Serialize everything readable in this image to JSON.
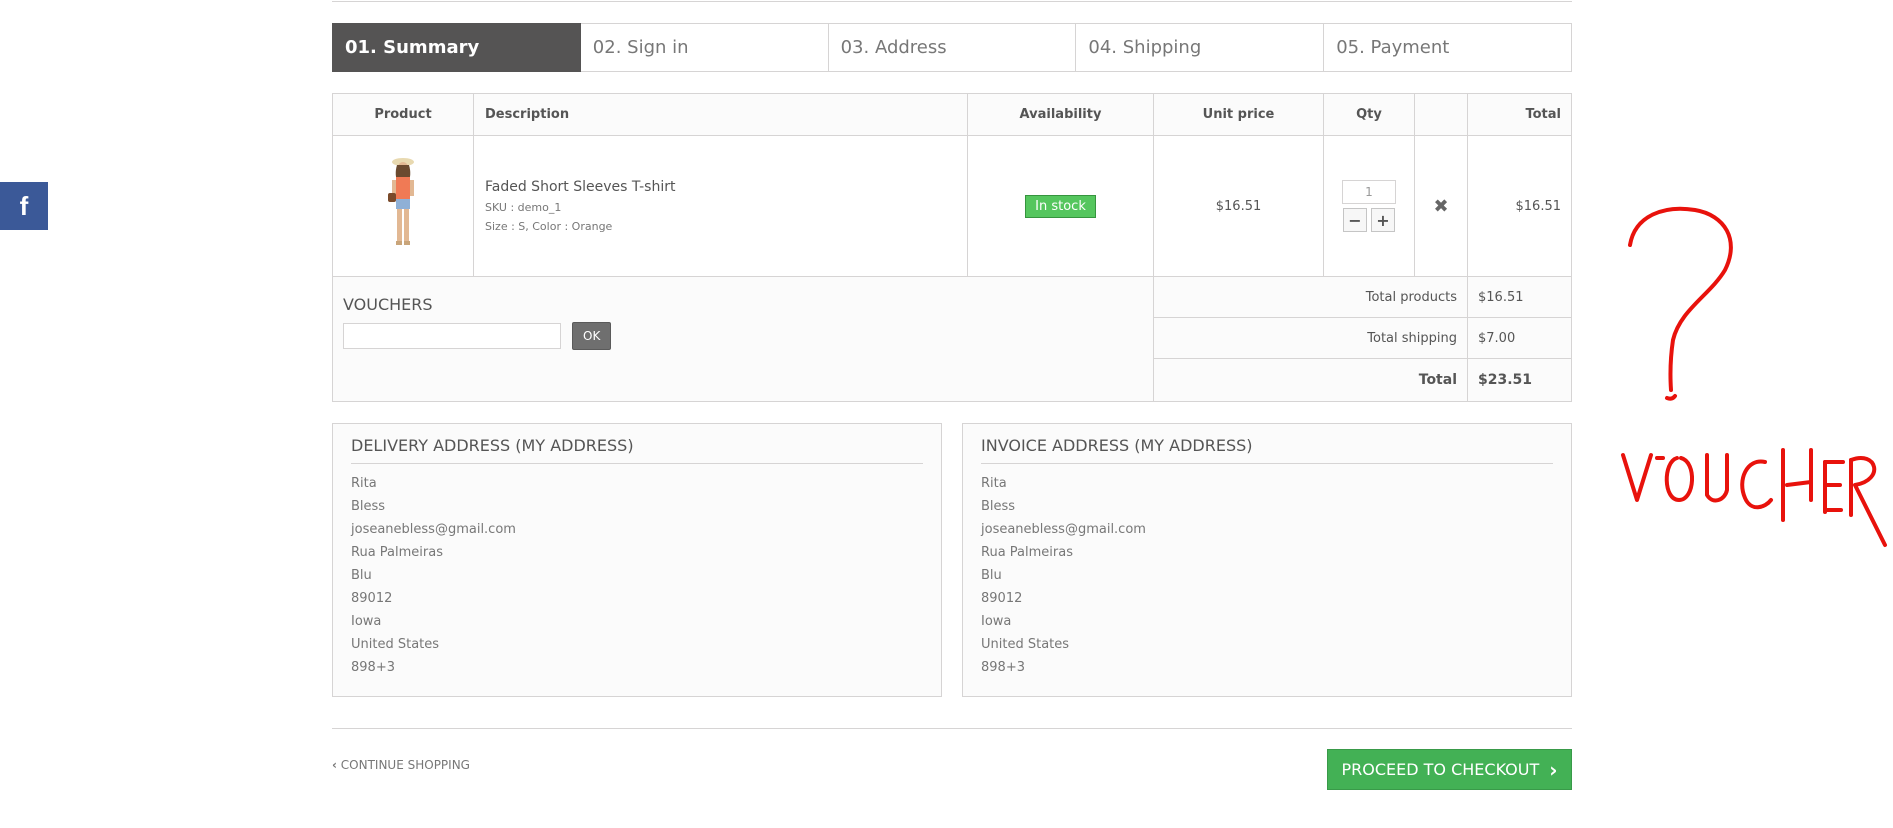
{
  "social": {
    "facebook_label": "f"
  },
  "steps": [
    {
      "label": "01. Summary",
      "active": true
    },
    {
      "label": "02. Sign in"
    },
    {
      "label": "03. Address"
    },
    {
      "label": "04. Shipping"
    },
    {
      "label": "05. Payment"
    }
  ],
  "cart": {
    "headers": {
      "product": "Product",
      "description": "Description",
      "availability": "Availability",
      "unit_price": "Unit price",
      "qty": "Qty",
      "total": "Total"
    },
    "item": {
      "name": "Faded Short Sleeves T-shirt",
      "sku": "SKU : demo_1",
      "attributes": "Size : S, Color : Orange",
      "availability": "In stock",
      "unit_price": "$16.51",
      "qty": "1",
      "total": "$16.51"
    },
    "vouchers": {
      "title": "VOUCHERS",
      "ok_label": "OK",
      "input_value": ""
    },
    "totals": {
      "products_label": "Total products",
      "products_value": "$16.51",
      "shipping_label": "Total shipping",
      "shipping_value": "$7.00",
      "total_label": "Total",
      "total_value": "$23.51"
    }
  },
  "delivery_address": {
    "title": "DELIVERY ADDRESS (MY ADDRESS)",
    "lines": [
      "Rita",
      "Bless",
      "joseanebless@gmail.com",
      "Rua Palmeiras",
      "Blu",
      "89012",
      "Iowa",
      "United States",
      "898+3"
    ]
  },
  "invoice_address": {
    "title": "INVOICE ADDRESS (MY ADDRESS)",
    "lines": [
      "Rita",
      "Bless",
      "joseanebless@gmail.com",
      "Rua Palmeiras",
      "Blu",
      "89012",
      "Iowa",
      "United States",
      "898+3"
    ]
  },
  "actions": {
    "continue_label": "CONTINUE SHOPPING",
    "checkout_label": "PROCEED TO CHECKOUT"
  },
  "annotation": {
    "text": "VOUCHER",
    "color": "#e8120c"
  },
  "colors": {
    "accent_green": "#43b155",
    "active_step": "#555454",
    "facebook": "#3b5998"
  }
}
